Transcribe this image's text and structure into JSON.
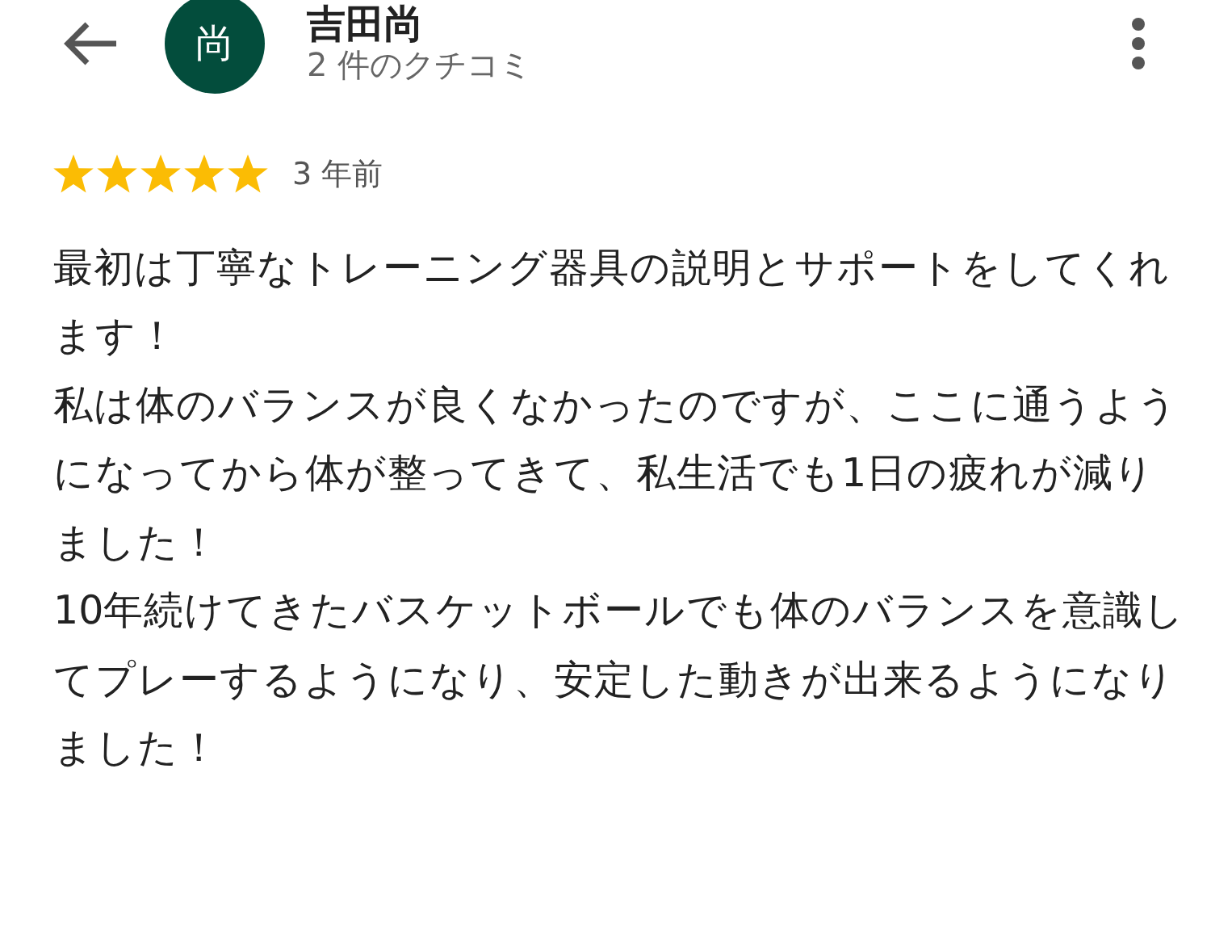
{
  "header": {
    "avatar_letter": "尚",
    "name": "吉田尚",
    "subtitle": "2 件のクチコミ"
  },
  "review": {
    "stars": 5,
    "time": "3 年前",
    "paragraphs": [
      "最初は丁寧なトレーニング器具の説明とサポートをしてくれます！",
      "私は体のバランスが良くなかったのですが、ここに通うようになってから体が整ってきて、私生活でも1日の疲れが減りました！",
      "10年続けてきたバスケットボールでも体のバランスを意識してプレーするようになり、安定した動きが出来るようになりました！"
    ]
  }
}
